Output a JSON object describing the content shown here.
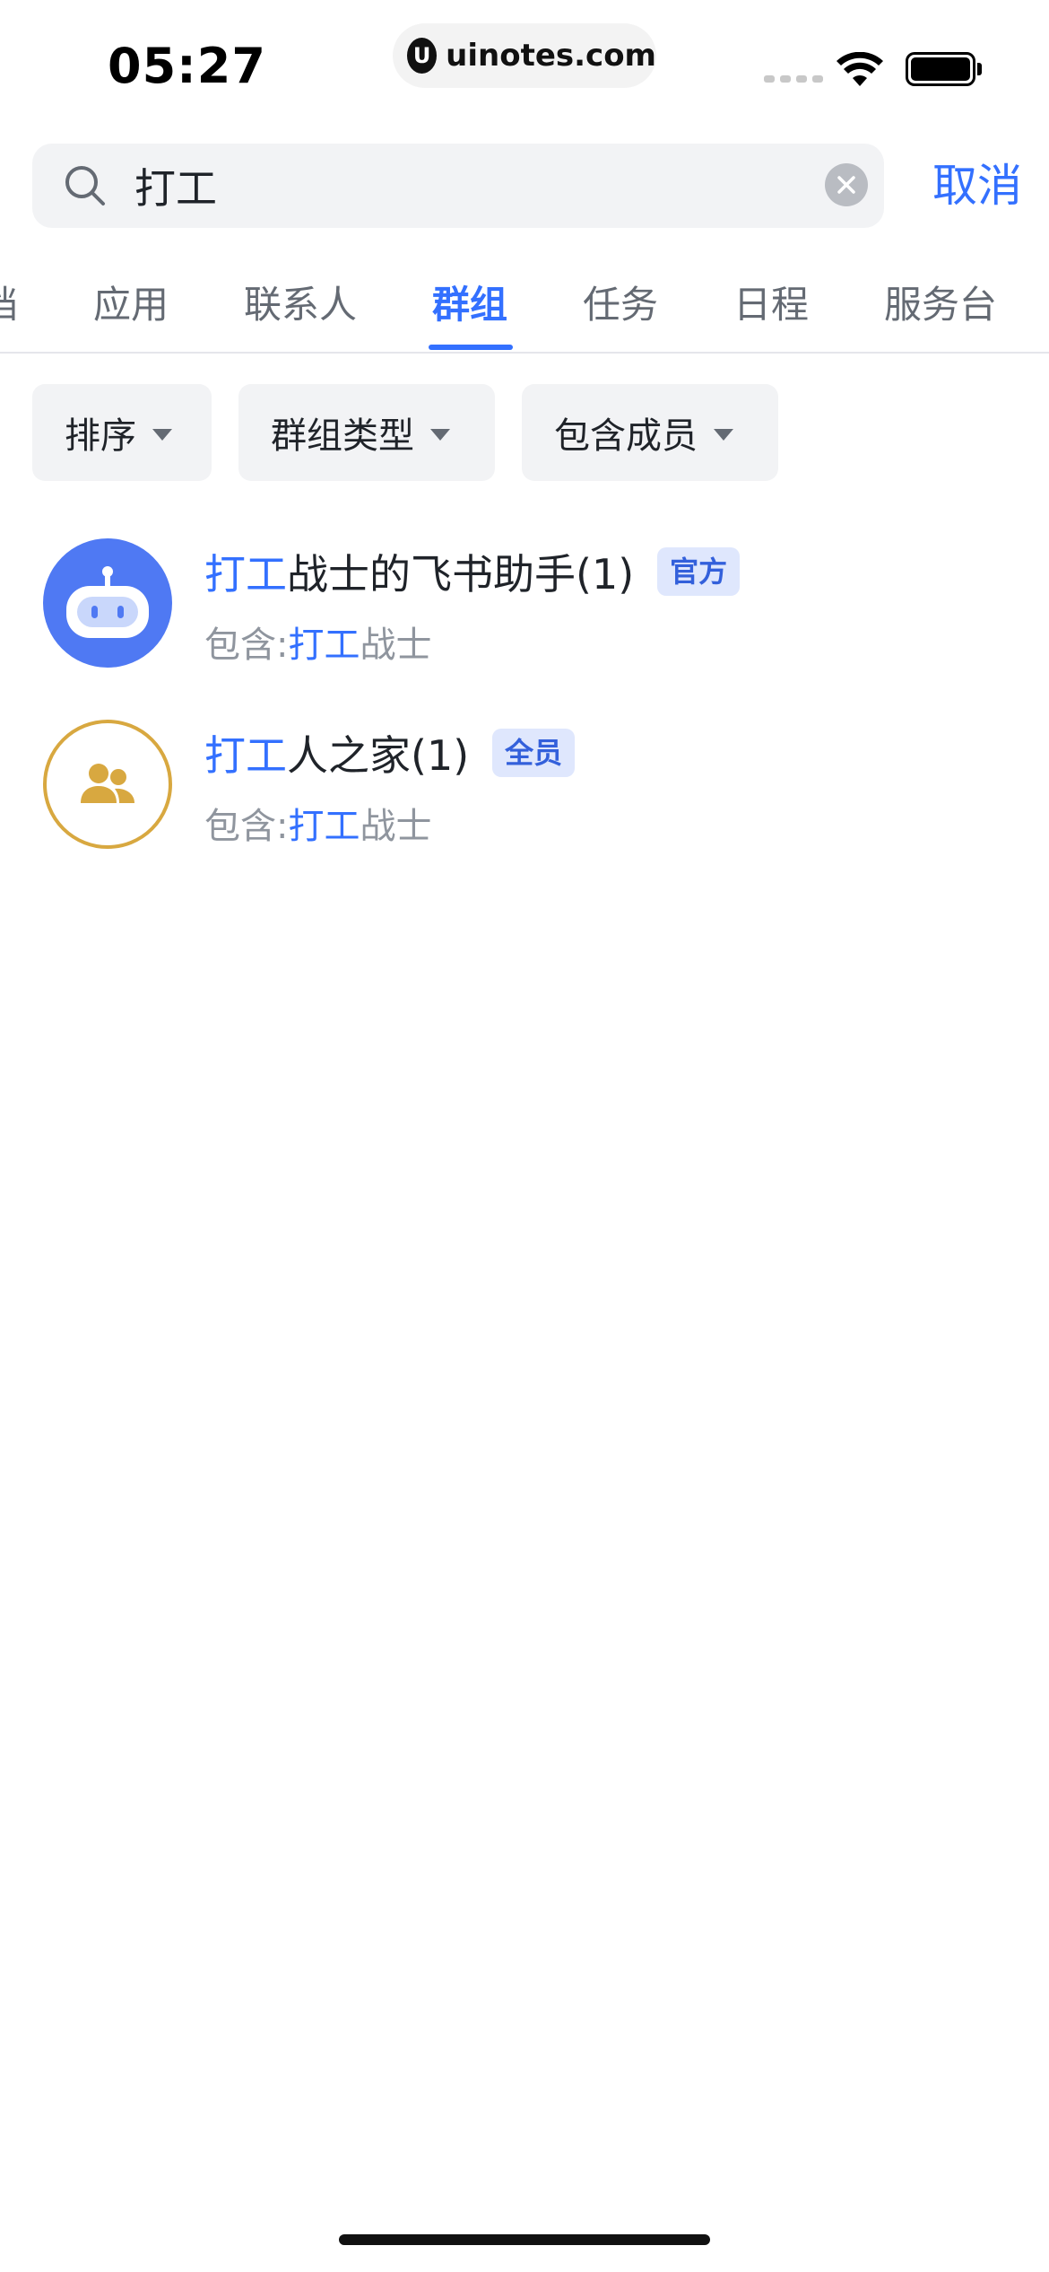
{
  "status_bar": {
    "time": "05:27",
    "url": "uinotes.com",
    "url_logo_letter": "U"
  },
  "search": {
    "query": "打工",
    "cancel_label": "取消"
  },
  "tabs": [
    {
      "label": "文档",
      "active": false
    },
    {
      "label": "应用",
      "active": false
    },
    {
      "label": "联系人",
      "active": false
    },
    {
      "label": "群组",
      "active": true
    },
    {
      "label": "任务",
      "active": false
    },
    {
      "label": "日程",
      "active": false
    },
    {
      "label": "服务台",
      "active": false
    }
  ],
  "filters": [
    {
      "label": "排序"
    },
    {
      "label": "群组类型"
    },
    {
      "label": "包含成员"
    }
  ],
  "results": [
    {
      "title_highlight": "打工",
      "title_rest": "战士的飞书助手(1)",
      "badge": "官方",
      "sub_prefix": "包含:",
      "sub_highlight": "打工",
      "sub_rest": "战士",
      "avatar_icon": "robot-icon"
    },
    {
      "title_highlight": "打工",
      "title_rest": "人之家(1)",
      "badge": "全员",
      "sub_prefix": "包含:",
      "sub_highlight": "打工",
      "sub_rest": "战士",
      "avatar_icon": "group-icon"
    }
  ],
  "colors": {
    "accent": "#3370ff",
    "robot_avatar": "#4f79f3",
    "group_avatar_ring": "#d8a840"
  }
}
